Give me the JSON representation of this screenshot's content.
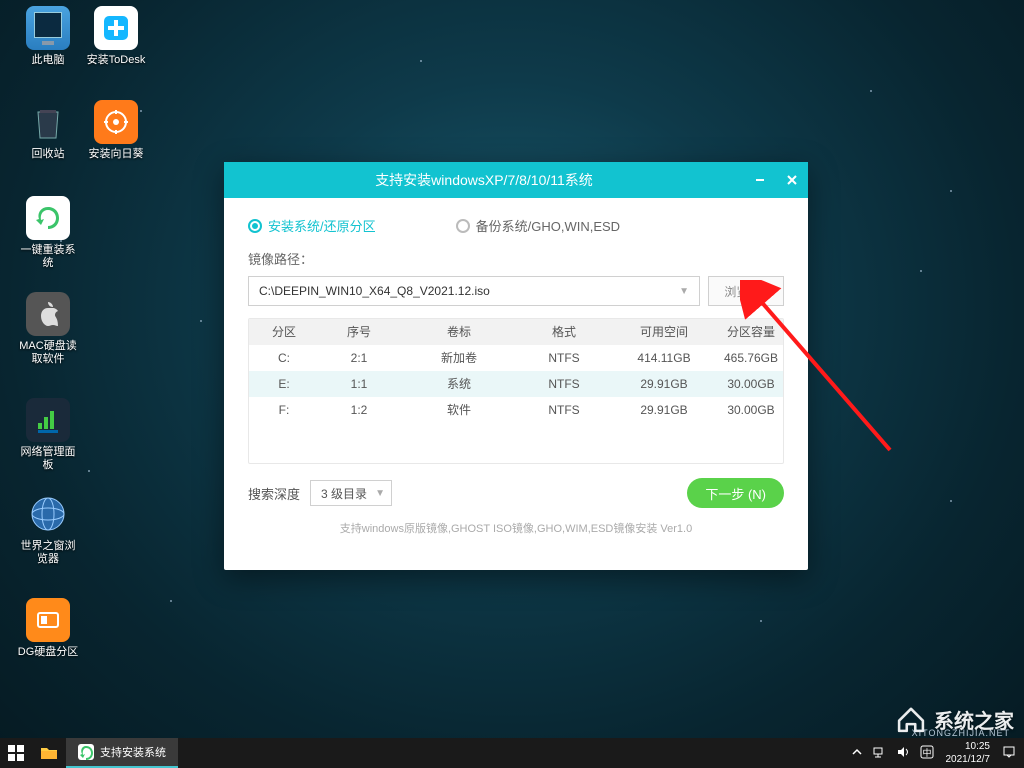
{
  "desktop_icons": [
    {
      "label": "此电脑",
      "key": "this-pc"
    },
    {
      "label": "安装ToDesk",
      "key": "todesk"
    },
    {
      "label": "回收站",
      "key": "recycle"
    },
    {
      "label": "安装向日葵",
      "key": "sunflower"
    },
    {
      "label": "一键重装系统",
      "key": "reinstall"
    },
    {
      "label": "MAC硬盘读取软件",
      "key": "mac-disk"
    },
    {
      "label": "网络管理面板",
      "key": "netpanel"
    },
    {
      "label": "世界之窗浏览器",
      "key": "world-browser"
    },
    {
      "label": "DG硬盘分区",
      "key": "dg-partition"
    }
  ],
  "window": {
    "title": "支持安装windowsXP/7/8/10/11系统",
    "radio_install": "安装系统/还原分区",
    "radio_backup": "备份系统/GHO,WIN,ESD",
    "path_label": "镜像路径：",
    "path_value": "C:\\DEEPIN_WIN10_X64_Q8_V2021.12.iso",
    "browse_label": "浏览 (B)",
    "headers": {
      "part": "分区",
      "num": "序号",
      "vol": "卷标",
      "fmt": "格式",
      "free": "可用空间",
      "cap": "分区容量"
    },
    "rows": [
      {
        "part": "C:",
        "num": "2:1",
        "vol": "新加卷",
        "fmt": "NTFS",
        "free": "414.11GB",
        "cap": "465.76GB"
      },
      {
        "part": "E:",
        "num": "1:1",
        "vol": "系统",
        "fmt": "NTFS",
        "free": "29.91GB",
        "cap": "30.00GB"
      },
      {
        "part": "F:",
        "num": "1:2",
        "vol": "软件",
        "fmt": "NTFS",
        "free": "29.91GB",
        "cap": "30.00GB"
      }
    ],
    "depth_label": "搜索深度",
    "depth_value": "3 级目录",
    "next_label": "下一步 (N)",
    "footer": "支持windows原版镜像,GHOST ISO镜像,GHO,WIM,ESD镜像安装 Ver1.0"
  },
  "taskbar": {
    "task_label": "支持安装系统",
    "time": "10:25",
    "date": "2021/12/7"
  },
  "watermark": {
    "text": "系统之家",
    "sub": "XITONGZHIJIA.NET"
  }
}
